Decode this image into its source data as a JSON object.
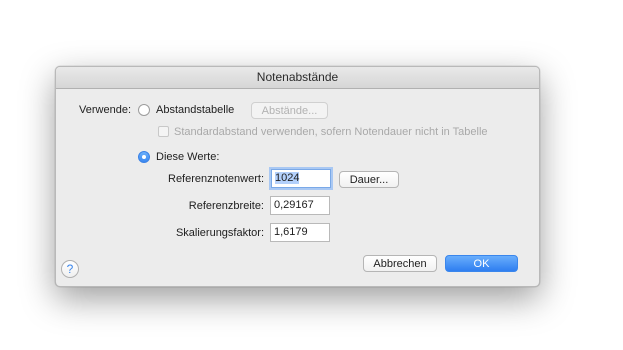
{
  "dialog": {
    "title": "Notenabstände",
    "use_label": "Verwende:",
    "option_table_label": "Abstandstabelle",
    "spacings_button": "Abstände...",
    "default_spacing_checkbox": "Standardabstand verwenden, sofern Notendauer nicht in Tabelle",
    "option_values_label": "Diese Werte:",
    "reference_note_value_label": "Referenznotenwert:",
    "reference_note_value": "1024",
    "duration_button": "Dauer...",
    "reference_width_label": "Referenzbreite:",
    "reference_width": "0,29167",
    "scaling_factor_label": "Skalierungsfaktor:",
    "scaling_factor": "1,6179",
    "help_icon": "question-mark-icon",
    "cancel_button": "Abbrechen",
    "ok_button": "OK"
  }
}
